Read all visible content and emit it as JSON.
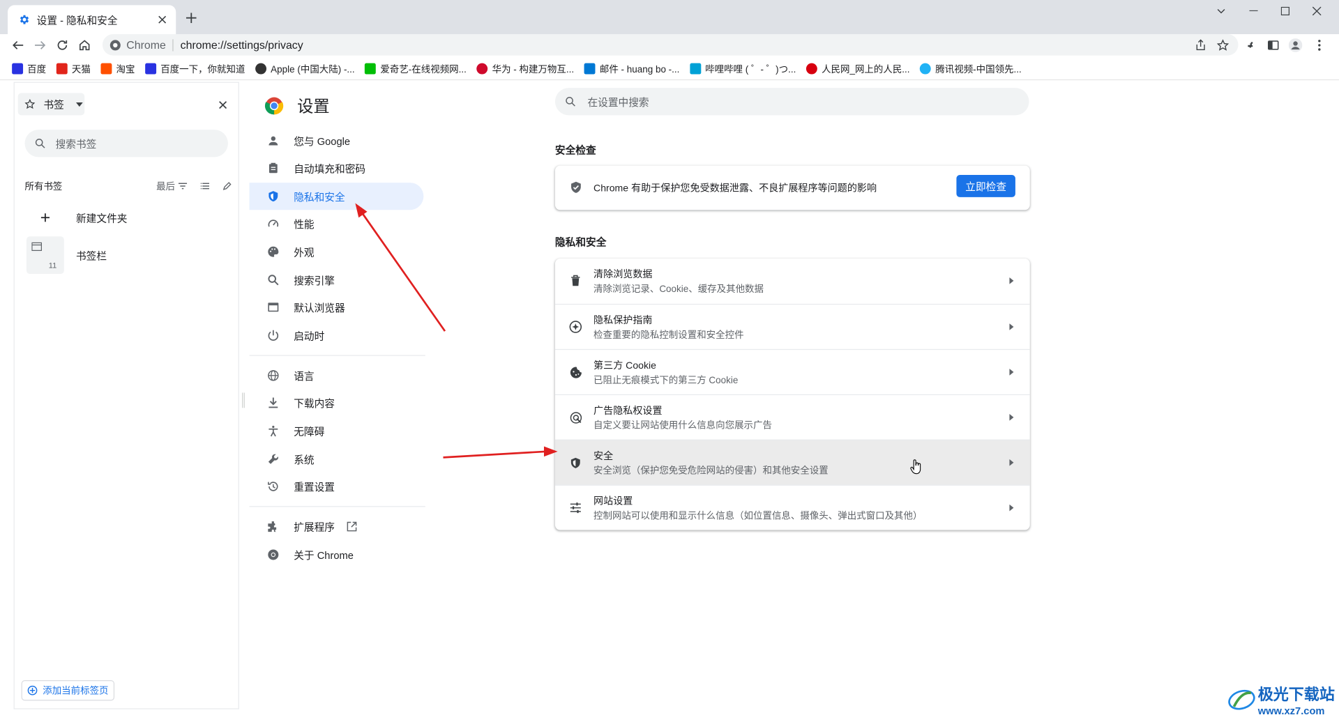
{
  "browser": {
    "tab_title": "设置 - 隐私和安全",
    "omnibox_chip": "Chrome",
    "url": "chrome://settings/privacy"
  },
  "bookmarks_bar": [
    {
      "label": "百度",
      "color": "#2932e1"
    },
    {
      "label": "天猫",
      "color": "#e1251b"
    },
    {
      "label": "淘宝",
      "color": "#ff5000"
    },
    {
      "label": "百度一下，你就知道",
      "color": "#2932e1"
    },
    {
      "label": "Apple (中国大陆) -...",
      "color": "#333333"
    },
    {
      "label": "爱奇艺-在线视频网...",
      "color": "#00be06"
    },
    {
      "label": "华为 - 构建万物互...",
      "color": "#cf0a2c"
    },
    {
      "label": "邮件 - huang bo -...",
      "color": "#0078d4"
    },
    {
      "label": "哔哩哔哩 ( ゜- ゜)つ...",
      "color": "#00a1d6"
    },
    {
      "label": "人民网_网上的人民...",
      "color": "#d7000f"
    },
    {
      "label": "腾讯视频-中国领先...",
      "color": "#20b2f5"
    }
  ],
  "side_panel": {
    "header": "书签",
    "search_placeholder": "搜索书签",
    "all_label": "所有书签",
    "sort_label": "最后",
    "new_folder": "新建文件夹",
    "bookmarks_bar_folder": "书签栏",
    "bookmarks_bar_count": "11",
    "add_current": "添加当前标签页"
  },
  "settings": {
    "title": "设置",
    "search_placeholder": "在设置中搜索",
    "nav": [
      {
        "label": "您与 Google",
        "icon": "person-icon"
      },
      {
        "label": "自动填充和密码",
        "icon": "clipboard-icon"
      },
      {
        "label": "隐私和安全",
        "icon": "shield-icon",
        "active": true
      },
      {
        "label": "性能",
        "icon": "speedometer-icon"
      },
      {
        "label": "外观",
        "icon": "palette-icon"
      },
      {
        "label": "搜索引擎",
        "icon": "search-icon"
      },
      {
        "label": "默认浏览器",
        "icon": "browser-icon"
      },
      {
        "label": "启动时",
        "icon": "power-icon"
      },
      {
        "label": "语言",
        "icon": "globe-icon"
      },
      {
        "label": "下载内容",
        "icon": "download-icon"
      },
      {
        "label": "无障碍",
        "icon": "accessibility-icon"
      },
      {
        "label": "系统",
        "icon": "wrench-icon"
      },
      {
        "label": "重置设置",
        "icon": "history-icon"
      },
      {
        "label": "扩展程序",
        "icon": "puzzle-icon"
      },
      {
        "label": "关于 Chrome",
        "icon": "chrome-icon"
      }
    ],
    "safety_check": {
      "section_title": "安全检查",
      "text": "Chrome 有助于保护您免受数据泄露、不良扩展程序等问题的影响",
      "button": "立即检查"
    },
    "privacy_section_title": "隐私和安全",
    "privacy_rows": [
      {
        "title": "清除浏览数据",
        "subtitle": "清除浏览记录、Cookie、缓存及其他数据",
        "icon": "trash-icon"
      },
      {
        "title": "隐私保护指南",
        "subtitle": "检查重要的隐私控制设置和安全控件",
        "icon": "compass-icon"
      },
      {
        "title": "第三方 Cookie",
        "subtitle": "已阻止无痕模式下的第三方 Cookie",
        "icon": "cookie-icon"
      },
      {
        "title": "广告隐私权设置",
        "subtitle": "自定义要让网站使用什么信息向您展示广告",
        "icon": "ad-privacy-icon"
      },
      {
        "title": "安全",
        "subtitle": "安全浏览（保护您免受危险网站的侵害）和其他安全设置",
        "icon": "shield-icon",
        "hovered": true
      },
      {
        "title": "网站设置",
        "subtitle": "控制网站可以使用和显示什么信息（如位置信息、摄像头、弹出式窗口及其他）",
        "icon": "sliders-icon"
      }
    ]
  },
  "watermark": {
    "title": "极光下载站",
    "url": "www.xz7.com"
  },
  "colors": {
    "accent": "#1a73e8",
    "annotation_arrow": "#e02020",
    "active_nav_bg": "#e8f0fe"
  }
}
